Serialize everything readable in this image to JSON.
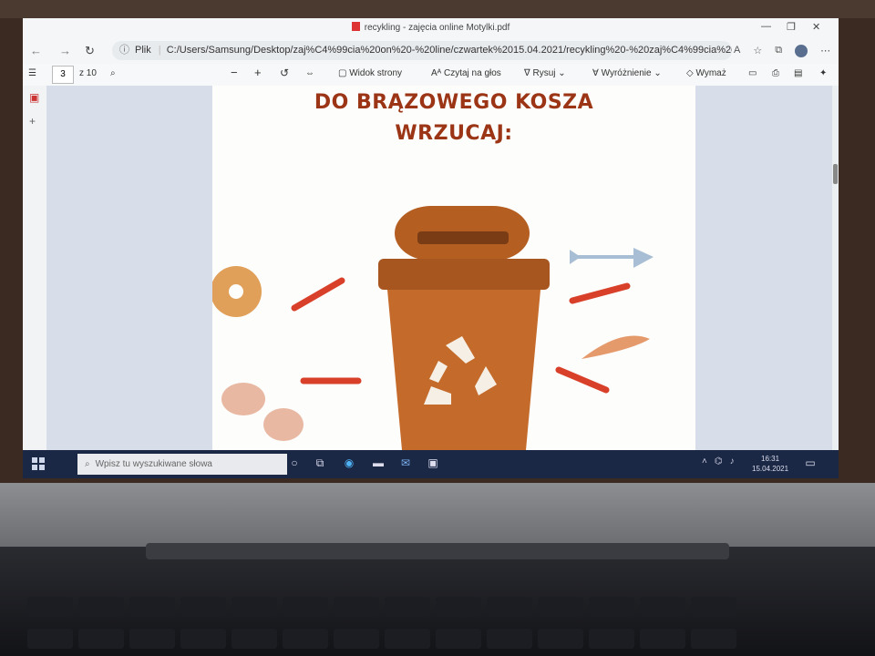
{
  "window": {
    "title": "recykling - zajęcia online Motylki.pdf"
  },
  "address_bar": {
    "scheme_label": "Plik",
    "url": "C:/Users/Samsung/Desktop/zaj%C4%99cia%20on%20-%20line/czwartek%2015.04.2021/recykling%20-%20zaj%C4%99cia%20online%20Moty..."
  },
  "pdf_toolbar": {
    "page_number": "3",
    "page_total": "z 10",
    "zoom_out": "−",
    "zoom_in": "+",
    "page_view": "Widok strony",
    "read_aloud": "Czytaj na głos",
    "draw": "Rysuj",
    "highlight": "Wyróżnienie",
    "erase": "Wymaż"
  },
  "document": {
    "headline_line1": "DO BRĄZOWEGO KOSZA",
    "headline_line2": "WRZUCAJ:"
  },
  "taskbar": {
    "search_placeholder": "Wpisz tu wyszukiwane słowa",
    "time": "16:31",
    "date": "15.04.2021"
  },
  "colors": {
    "headline": "#9b3516",
    "bin_body": "#c46a2a",
    "bin_lid": "#a8561f",
    "arrow": "#d8402a",
    "taskbar": "#1a2845"
  }
}
